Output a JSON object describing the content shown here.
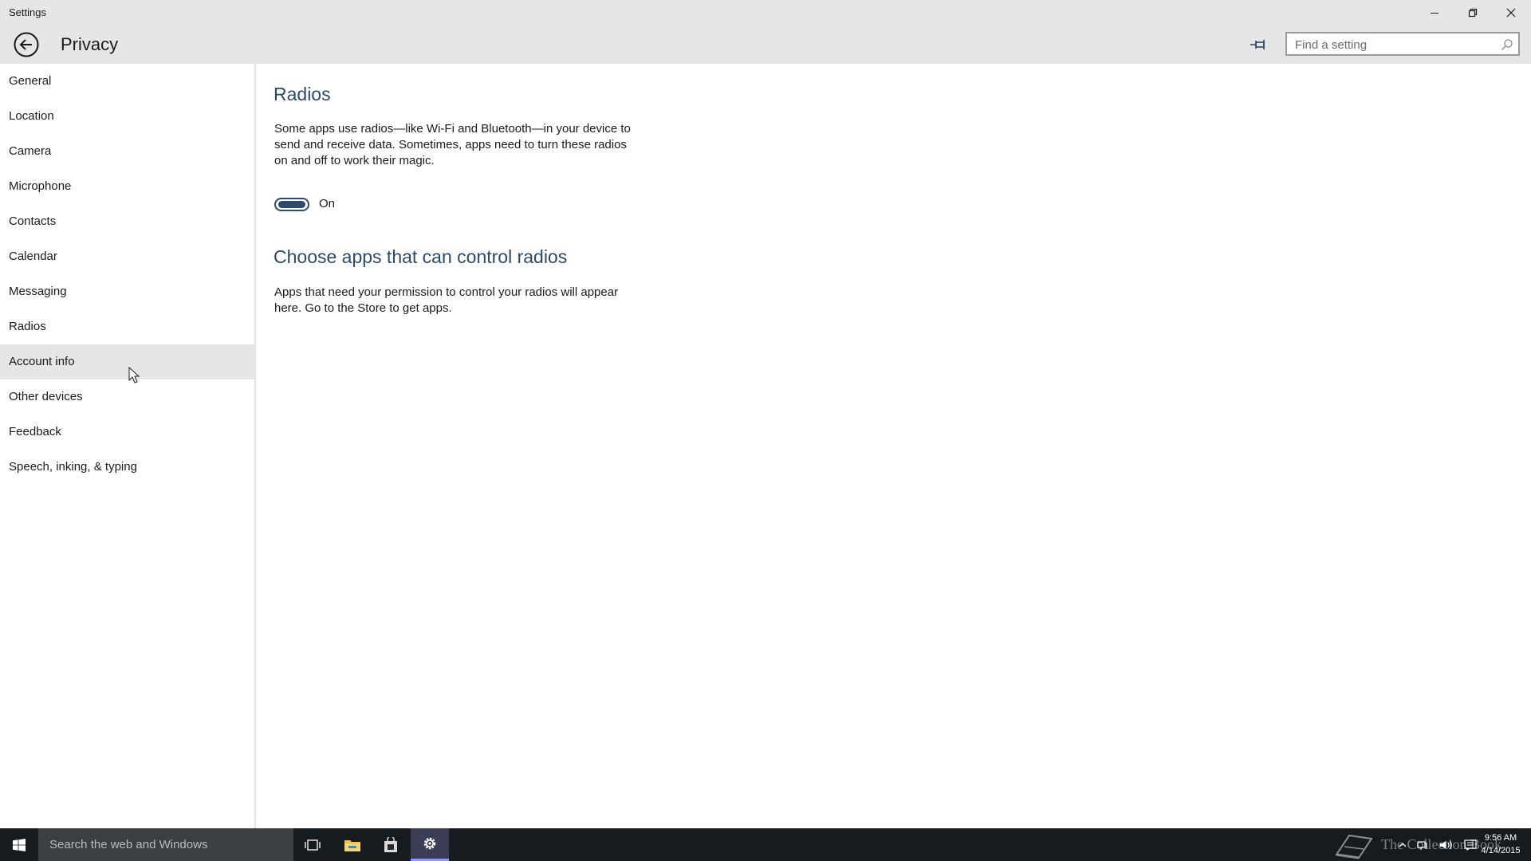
{
  "window": {
    "title": "Settings"
  },
  "header": {
    "title": "Privacy",
    "search_placeholder": "Find a setting"
  },
  "sidebar": {
    "items": [
      {
        "label": "General"
      },
      {
        "label": "Location"
      },
      {
        "label": "Camera"
      },
      {
        "label": "Microphone"
      },
      {
        "label": "Contacts"
      },
      {
        "label": "Calendar"
      },
      {
        "label": "Messaging"
      },
      {
        "label": "Radios"
      },
      {
        "label": "Account info"
      },
      {
        "label": "Other devices"
      },
      {
        "label": "Feedback"
      },
      {
        "label": "Speech, inking, & typing"
      }
    ],
    "hovered_item": "Account info"
  },
  "content": {
    "heading": "Radios",
    "description": "Some apps use radios—like Wi-Fi and Bluetooth—in your device to send and receive data. Sometimes, apps need to turn these radios on and off to work their magic.",
    "toggle_state": "On",
    "section_heading": "Choose apps that can control radios",
    "section_description": "Apps that need your permission to control your radios will appear here. Go to the Store to get apps."
  },
  "taskbar": {
    "search_placeholder": "Search the web and Windows",
    "watermark": "The Collection Book",
    "clock_time": "9:56 AM",
    "clock_date": "4/14/2015"
  },
  "colors": {
    "accent": "#2d4a6b",
    "chrome": "#e6e6e6",
    "taskbar": "#161b1f"
  },
  "icons": {
    "back": "back-arrow-icon",
    "pin": "pin-icon",
    "search": "search-icon",
    "start": "windows-logo-icon",
    "task_view": "task-view-icon",
    "file_explorer": "folder-icon",
    "store": "store-bag-icon",
    "settings": "gear-icon"
  }
}
